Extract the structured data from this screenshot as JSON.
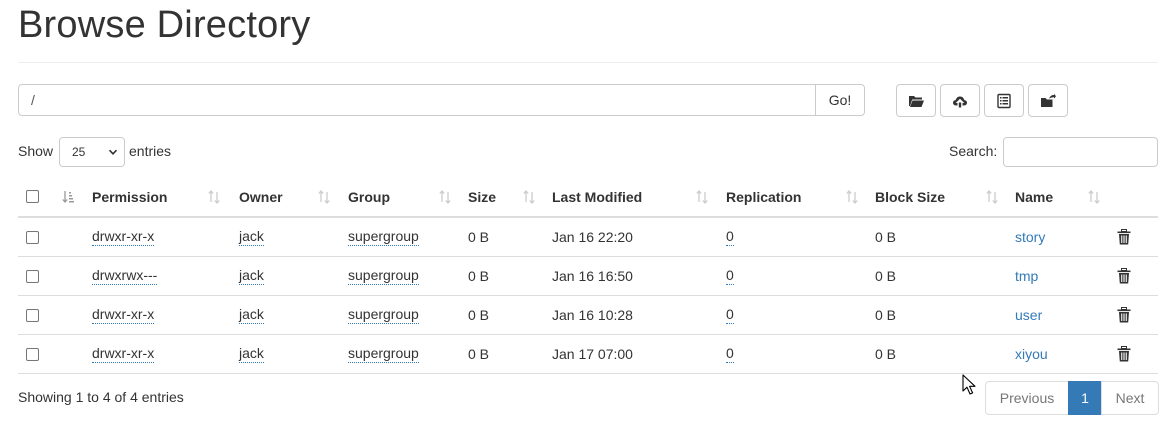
{
  "page": {
    "title": "Browse Directory"
  },
  "path_bar": {
    "value": "/",
    "go_label": "Go!"
  },
  "toolbar": {
    "buttons": [
      {
        "icon": "folder-open-icon"
      },
      {
        "icon": "cloud-upload-icon"
      },
      {
        "icon": "list-alt-icon"
      },
      {
        "icon": "folder-share-icon"
      }
    ]
  },
  "length": {
    "show_label": "Show",
    "value": "25",
    "entries_label": "entries"
  },
  "search": {
    "label": "Search:",
    "value": ""
  },
  "table": {
    "columns": [
      "Permission",
      "Owner",
      "Group",
      "Size",
      "Last Modified",
      "Replication",
      "Block Size",
      "Name"
    ],
    "rows": [
      {
        "permission": "drwxr-xr-x",
        "owner": "jack",
        "group": "supergroup",
        "size": "0 B",
        "modified": "Jan 16 22:20",
        "replication": "0",
        "block_size": "0 B",
        "name": "story"
      },
      {
        "permission": "drwxrwx---",
        "owner": "jack",
        "group": "supergroup",
        "size": "0 B",
        "modified": "Jan 16 16:50",
        "replication": "0",
        "block_size": "0 B",
        "name": "tmp"
      },
      {
        "permission": "drwxr-xr-x",
        "owner": "jack",
        "group": "supergroup",
        "size": "0 B",
        "modified": "Jan 16 10:28",
        "replication": "0",
        "block_size": "0 B",
        "name": "user"
      },
      {
        "permission": "drwxr-xr-x",
        "owner": "jack",
        "group": "supergroup",
        "size": "0 B",
        "modified": "Jan 17 07:00",
        "replication": "0",
        "block_size": "0 B",
        "name": "xiyou"
      }
    ]
  },
  "footer": {
    "info": "Showing 1 to 4 of 4 entries",
    "pagination": {
      "previous": "Previous",
      "current": "1",
      "next": "Next"
    }
  },
  "colors": {
    "link": "#337ab7",
    "active_page": "#337ab7",
    "border": "#dddddd"
  }
}
